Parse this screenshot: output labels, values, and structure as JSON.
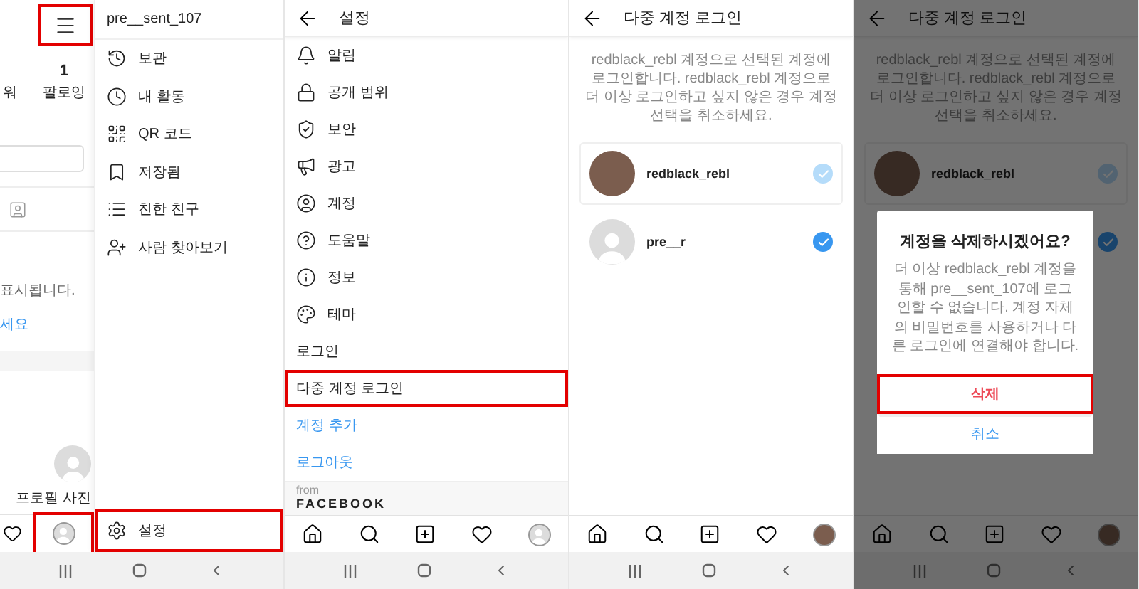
{
  "profile_menu_screen": {
    "menu_button": {
      "highlighted": true
    },
    "stats": [
      {
        "label": "워"
      },
      {
        "value": "1",
        "label": "팔로잉"
      }
    ],
    "notice": "표시됩니다.",
    "link": "세요",
    "photo_caption": "프로필 사진",
    "profile_tab": {
      "highlighted": true
    },
    "drawer": {
      "username": "pre__sent_107",
      "items": [
        {
          "label": "보관"
        },
        {
          "label": "내 활동"
        },
        {
          "label": "QR 코드"
        },
        {
          "label": "저장됨"
        },
        {
          "label": "친한 친구"
        },
        {
          "label": "사람 찾아보기"
        }
      ],
      "settings": {
        "label": "설정",
        "highlighted": true
      }
    }
  },
  "settings_screen": {
    "title": "설정",
    "items": [
      {
        "label": "알림",
        "kind": "icon",
        "highlighted": false
      },
      {
        "label": "공개 범위",
        "kind": "icon",
        "highlighted": false
      },
      {
        "label": "보안",
        "kind": "icon",
        "highlighted": false
      },
      {
        "label": "광고",
        "kind": "icon",
        "highlighted": false
      },
      {
        "label": "계정",
        "kind": "icon",
        "highlighted": false
      },
      {
        "label": "도움말",
        "kind": "icon",
        "highlighted": false
      },
      {
        "label": "정보",
        "kind": "icon",
        "highlighted": false
      },
      {
        "label": "테마",
        "kind": "icon",
        "highlighted": false
      },
      {
        "label": "로그인",
        "kind": "section",
        "highlighted": false
      },
      {
        "label": "다중 계정 로그인",
        "kind": "section",
        "highlighted": true
      },
      {
        "label": "계정 추가",
        "kind": "link",
        "highlighted": false
      },
      {
        "label": "로그아웃",
        "kind": "link",
        "highlighted": false
      }
    ],
    "footer": {
      "from": "from",
      "brand": "FACEBOOK"
    },
    "profile_photo": false
  },
  "multi_account_screen": {
    "title": "다중 계정 로그인",
    "description": "redblack_rebl 계정으로 선택된 계정에 로그인합니다. redblack_rebl 계정으로 더 이상 로그인하고 싶지 않은 경우 계정 선택을 취소하세요.",
    "accounts": [
      {
        "name": "redblack_rebl",
        "photo": true,
        "checked": true,
        "disabled": true
      },
      {
        "name": "pre__r",
        "photo": false,
        "checked": true,
        "disabled": false
      }
    ],
    "profile_photo": true
  },
  "delete_dialog_screen": {
    "title": "다중 계정 로그인",
    "description": "redblack_rebl 계정으로 선택된 계정에 로그인합니다. redblack_rebl 계정으로 더 이상 로그인하고 싶지 않은 경우 계정 선택을 취소하세요.",
    "accounts": [
      {
        "name": "redblack_rebl",
        "photo": true,
        "checked": true,
        "disabled": true
      },
      {
        "checked": true,
        "disabled": false
      }
    ],
    "profile_photo": true,
    "dialog": {
      "title": "계정을 삭제하시겠어요?",
      "message": "더 이상 redblack_rebl 계정을 통해 pre__sent_107에 로그인할 수 없습니다. 계정 자체의 비밀번호를 사용하거나 다른 로그인에 연결해야 합니다.",
      "buttons": [
        {
          "label": "삭제",
          "kind": "destructive",
          "highlighted": true
        },
        {
          "label": "취소",
          "kind": "cancel",
          "highlighted": false
        }
      ]
    }
  }
}
